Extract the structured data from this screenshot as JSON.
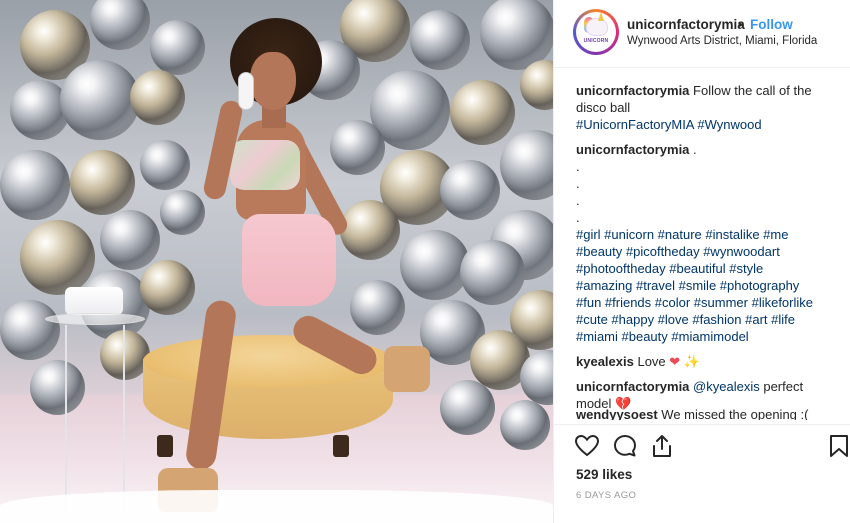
{
  "post": {
    "username": "unicornfactorymia",
    "separator": "•",
    "follow_label": "Follow",
    "location": "Wynwood Arts District, Miami, Florida",
    "avatar_word": "UNICORN"
  },
  "caption": {
    "username": "unicornfactorymia",
    "text": "Follow the call of the disco ball",
    "hashtags": "#UnicornFactoryMIA #Wynwood"
  },
  "comments": [
    {
      "username": "unicornfactorymia",
      "text": ".",
      "dots": [
        ".",
        ".",
        ".",
        "."
      ],
      "hashtags": [
        "#girl #unicorn #nature #instalike #me",
        "#beauty #picoftheday #wynwoodart",
        "#photooftheday #beautiful #style",
        "#amazing #travel #smile #photography",
        "#fun #friends #color #summer #likeforlike",
        "#cute #happy #love #fashion #art #life",
        "#miami #beauty #miamimodel"
      ]
    },
    {
      "username": "kyealexis",
      "text": "Love",
      "emoji1": "❤",
      "emoji2": "✨"
    },
    {
      "username": "unicornfactorymia",
      "mention": "@kyealexis",
      "text": "perfect",
      "text2": "model",
      "emoji": "💔"
    },
    {
      "username": "wendyysoest",
      "text": "We missed the opening :("
    }
  ],
  "likes": "529 likes",
  "time_ago": "6 DAYS AGO",
  "icons": [
    "heart-icon",
    "comment-icon",
    "share-icon",
    "bookmark-icon"
  ]
}
